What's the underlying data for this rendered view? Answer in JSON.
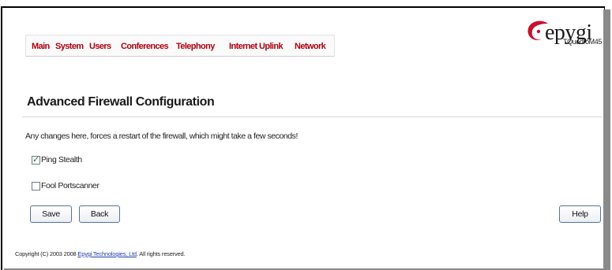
{
  "nav": {
    "items": [
      {
        "label": "Main"
      },
      {
        "label": "System"
      },
      {
        "label": "Users"
      },
      {
        "label": "Conferences"
      },
      {
        "label": "Telephony"
      },
      {
        "label": "Internet Uplink"
      },
      {
        "label": "Network"
      }
    ],
    "color": "#b0000e"
  },
  "brand": {
    "logo_text": "epygi",
    "model": "TQuadroM45",
    "logo_color": "#c8102e"
  },
  "page": {
    "title": "Advanced Firewall Configuration",
    "warning": "Any changes here, forces a restart of the firewall, which might take a few seconds!"
  },
  "options": [
    {
      "label": "Ping Stealth",
      "checked": true
    },
    {
      "label": "Fool Portscanner",
      "checked": false
    }
  ],
  "buttons": {
    "save": "Save",
    "back": "Back",
    "help": "Help"
  },
  "footer": {
    "prefix": "Copyright (C) 2003 2008 ",
    "company": "Epygi Technologies, Ltd",
    "suffix": ". All rights reserved."
  }
}
